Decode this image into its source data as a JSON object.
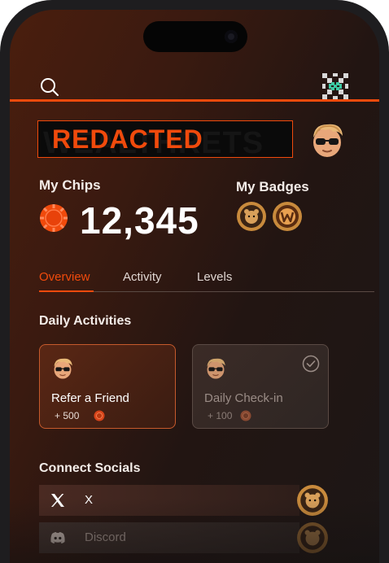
{
  "header": {
    "search_icon": "search-icon",
    "logo_icon": "pixel-x-logo-icon",
    "accent_color": "#f04a0c"
  },
  "profile": {
    "name_redacted": "REDACTED",
    "avatar_icon": "cartoon-avatar-sunglasses"
  },
  "chips": {
    "label": "My Chips",
    "value": "12,345"
  },
  "badges": {
    "label": "My Badges",
    "items": [
      "bear-badge-icon",
      "w-badge-icon"
    ]
  },
  "tabs": [
    {
      "label": "Overview",
      "active": true
    },
    {
      "label": "Activity",
      "active": false
    },
    {
      "label": "Levels",
      "active": false
    }
  ],
  "daily": {
    "title": "Daily Activities",
    "cards": [
      {
        "title": "Refer a Friend",
        "reward": "+ 500",
        "completed": false
      },
      {
        "title": "Daily Check-in",
        "reward": "+ 100",
        "completed": true
      }
    ]
  },
  "socials": {
    "title": "Connect Socials",
    "items": [
      {
        "label": "X",
        "icon": "x-logo-icon"
      },
      {
        "label": "Discord",
        "icon": "discord-icon"
      }
    ]
  }
}
